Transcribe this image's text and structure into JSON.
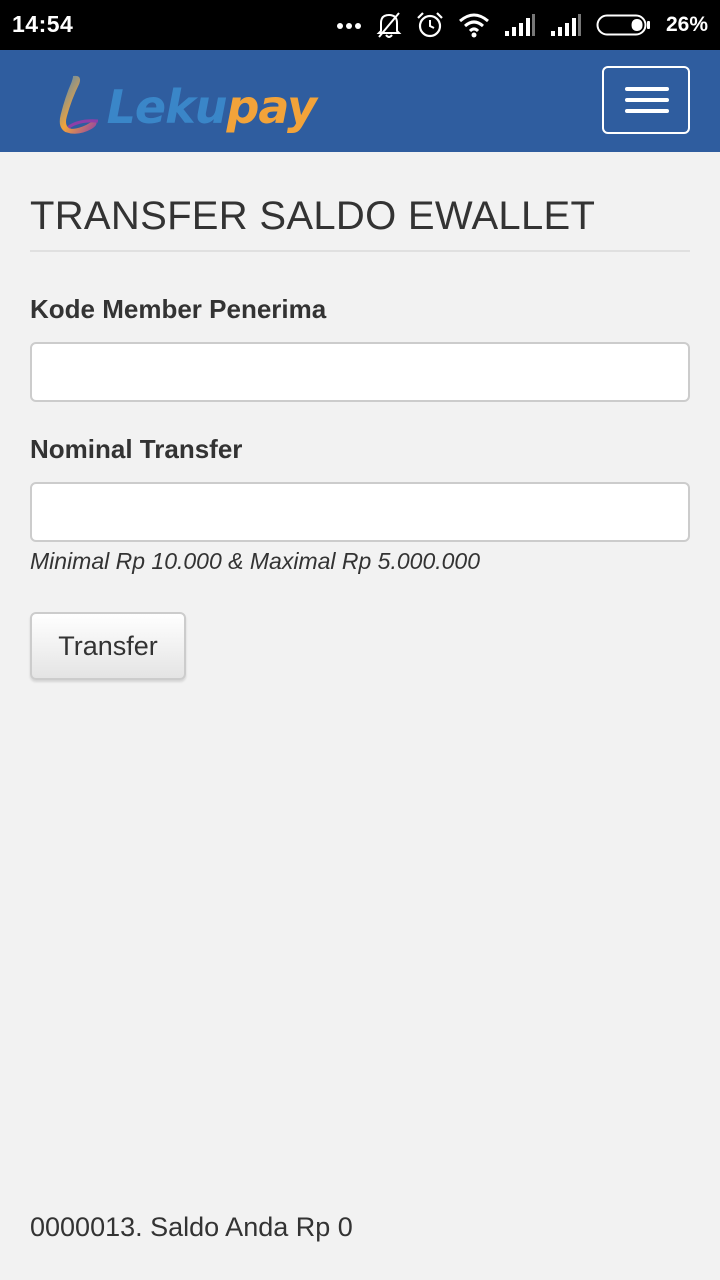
{
  "status_bar": {
    "time": "14:54",
    "battery_percent": "26%",
    "icons": [
      "more-dots-icon",
      "notifications-off-icon",
      "alarm-icon",
      "wifi-icon",
      "signal-icon",
      "signal-icon",
      "battery-icon"
    ],
    "battery_level": 0.26
  },
  "navbar": {
    "brand_part1": "Leku",
    "brand_part2": "pay",
    "brand_colors": {
      "leku": "#3a86c8",
      "pay": "#f2a33a"
    },
    "background": "#2f5d9f",
    "menu_icon": "hamburger-menu-icon"
  },
  "form": {
    "title": "TRANSFER SALDO EWALLET",
    "recipient_label": "Kode Member Penerima",
    "recipient_value": "",
    "amount_label": "Nominal Transfer",
    "amount_value": "",
    "amount_help": "Minimal Rp 10.000 & Maximal Rp 5.000.000",
    "submit_label": "Transfer"
  },
  "footer": {
    "balance_text": "0000013. Saldo Anda Rp 0"
  }
}
